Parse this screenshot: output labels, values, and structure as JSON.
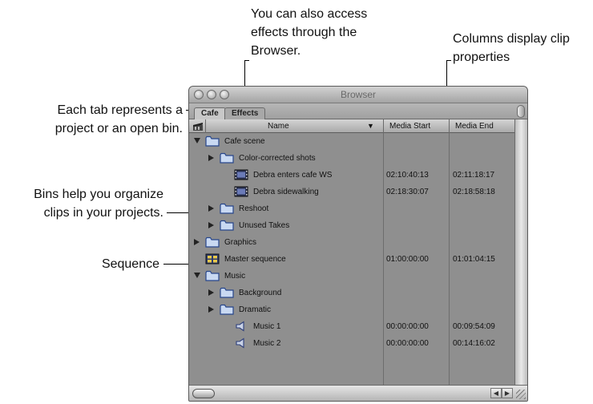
{
  "callouts": {
    "effects_browser": {
      "line1": "You can also access",
      "line2": "effects through the",
      "line3": "Browser."
    },
    "columns": {
      "line1": "Columns display clip",
      "line2": "properties"
    },
    "tabs": {
      "line1": "Each tab represents a",
      "line2": "project or an open bin."
    },
    "bins": {
      "line1": "Bins help you organize",
      "line2": "clips in your projects."
    },
    "sequence": {
      "line1": "Sequence"
    }
  },
  "window": {
    "title": "Browser",
    "tabs": [
      {
        "label": "Cafe",
        "active": true
      },
      {
        "label": "Effects",
        "active": false
      }
    ]
  },
  "columns": {
    "name": "Name",
    "media_start": "Media Start",
    "media_end": "Media End"
  },
  "rows": [
    {
      "name": "Cafe scene",
      "icon": "folder-icon",
      "disclosure": "expanded",
      "media_start": "",
      "media_end": ""
    },
    {
      "name": "Color-corrected shots",
      "icon": "folder-icon",
      "disclosure": "collapsed",
      "media_start": "",
      "media_end": ""
    },
    {
      "name": "Debra enters cafe WS",
      "icon": "clip-icon",
      "disclosure": "none",
      "media_start": "02:10:40:13",
      "media_end": "02:11:18:17"
    },
    {
      "name": "Debra sidewalking",
      "icon": "clip-icon",
      "disclosure": "none",
      "media_start": "02:18:30:07",
      "media_end": "02:18:58:18"
    },
    {
      "name": "Reshoot",
      "icon": "folder-icon",
      "disclosure": "collapsed",
      "media_start": "",
      "media_end": ""
    },
    {
      "name": "Unused Takes",
      "icon": "folder-icon",
      "disclosure": "collapsed",
      "media_start": "",
      "media_end": ""
    },
    {
      "name": "Graphics",
      "icon": "folder-icon",
      "disclosure": "collapsed",
      "media_start": "",
      "media_end": ""
    },
    {
      "name": "Master sequence",
      "icon": "sequence-icon",
      "disclosure": "none",
      "media_start": "01:00:00:00",
      "media_end": "01:01:04:15"
    },
    {
      "name": "Music",
      "icon": "folder-icon",
      "disclosure": "expanded",
      "media_start": "",
      "media_end": ""
    },
    {
      "name": "Background",
      "icon": "folder-icon",
      "disclosure": "collapsed",
      "media_start": "",
      "media_end": ""
    },
    {
      "name": "Dramatic",
      "icon": "folder-icon",
      "disclosure": "collapsed",
      "media_start": "",
      "media_end": ""
    },
    {
      "name": "Music 1",
      "icon": "audio-icon",
      "disclosure": "none",
      "media_start": "00:00:00:00",
      "media_end": "00:09:54:09"
    },
    {
      "name": "Music 2",
      "icon": "audio-icon",
      "disclosure": "none",
      "media_start": "00:00:00:00",
      "media_end": "00:14:16:02"
    }
  ],
  "colors": {
    "list_background": "#8f8f8f",
    "folder_fill": "#c9d9f2",
    "folder_stroke": "#27468b"
  }
}
